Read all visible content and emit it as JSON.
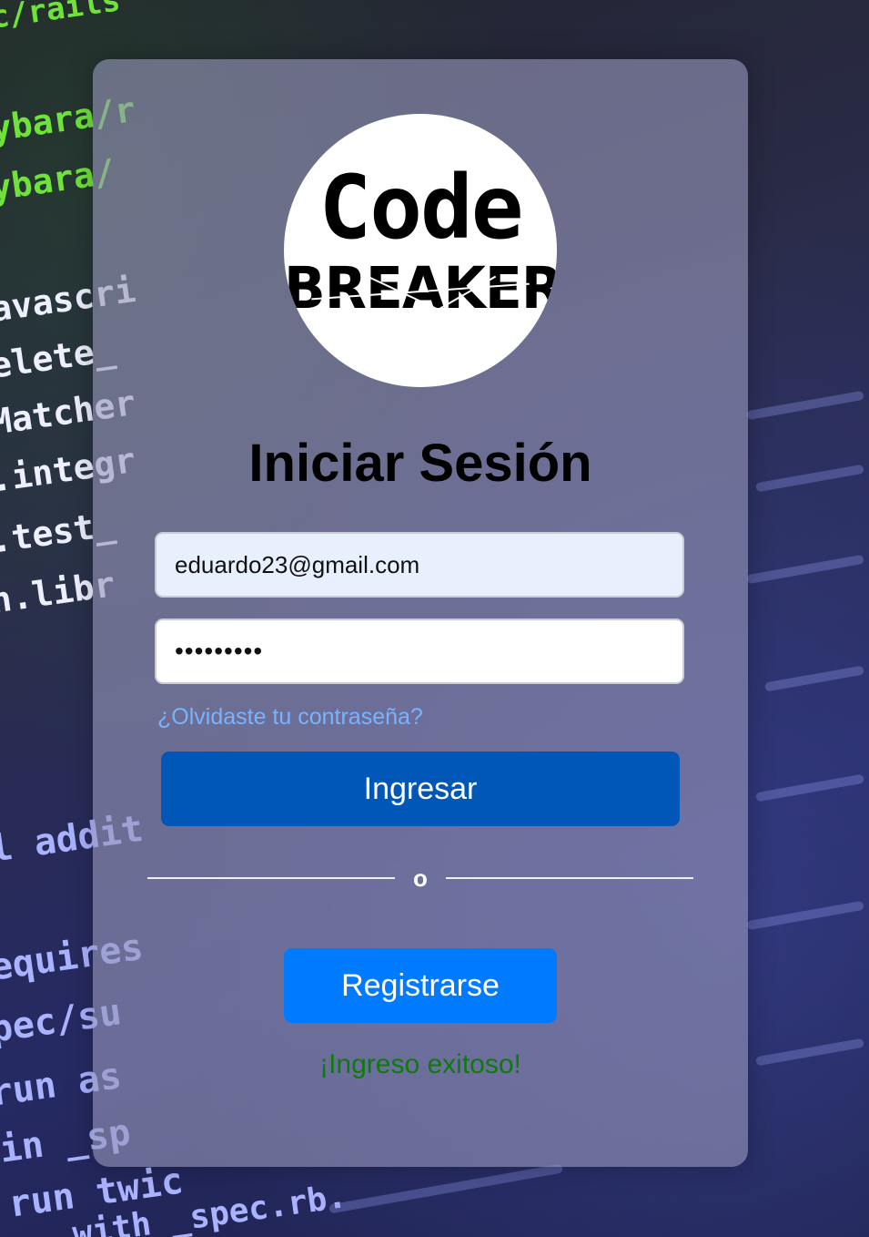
{
  "logo": {
    "line1": "Code",
    "line2": "BREAKER"
  },
  "login": {
    "title": "Iniciar Sesión",
    "email_value": "eduardo23@gmail.com",
    "password_value": "•••••••••",
    "forgot_password": "¿Olvidaste tu contraseña?",
    "submit_label": "Ingresar",
    "divider": "o",
    "register_label": "Registrarse",
    "status_message": "¡Ingreso exitoso!"
  },
  "background_code": {
    "lines": [
      "c/rails",
      "ybara/r",
      "ybara/",
      "avascri",
      "elete_",
      "Matcher",
      ".integr",
      ".test_",
      "n.libr",
      "l addit",
      "equires",
      "pec/su",
      "run as",
      "in _sp",
      "run twic",
      "with _spec.rb."
    ]
  },
  "colors": {
    "primary_button": "#0057b8",
    "secondary_button": "#007bff",
    "link": "#79b3ff",
    "success": "#0e7a0e"
  }
}
